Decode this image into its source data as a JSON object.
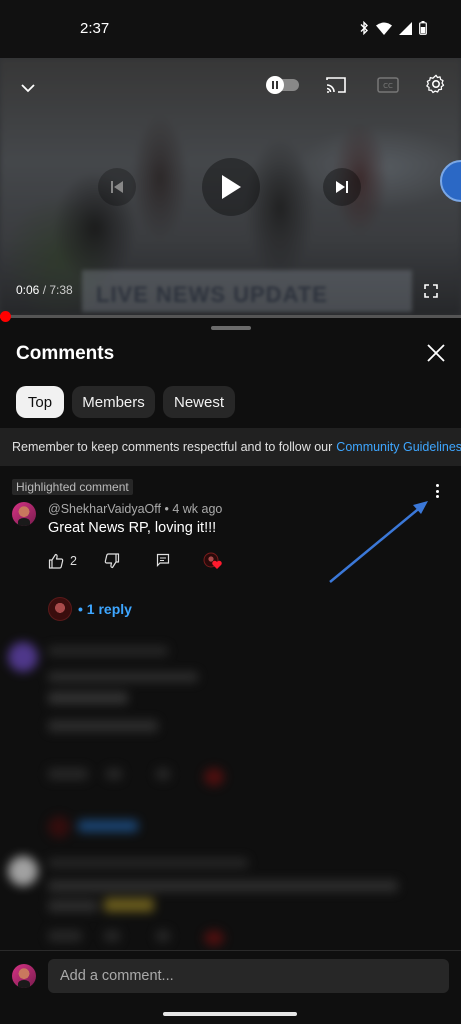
{
  "status_bar": {
    "time": "2:37",
    "icons": [
      "bluetooth-icon",
      "wifi-icon",
      "signal-icon",
      "battery-icon"
    ]
  },
  "player": {
    "current_time": "0:06",
    "duration": "7:38",
    "time_separator": " / ",
    "progress_fraction": 0.013,
    "overlay_text": "LIVE NEWS UPDATE",
    "controls": [
      "collapse-chevron-icon",
      "autoplay-toggle-icon",
      "cast-icon",
      "captions-icon",
      "settings-gear-icon",
      "previous-icon",
      "play-icon",
      "next-icon",
      "fullscreen-icon"
    ]
  },
  "comments": {
    "title": "Comments",
    "tabs": [
      {
        "label": "Top",
        "active": true
      },
      {
        "label": "Members",
        "active": false
      },
      {
        "label": "Newest",
        "active": false
      }
    ],
    "notice_text": "Remember to keep comments respectful and to follow our",
    "notice_link": "Community Guidelines",
    "highlighted_label": "Highlighted comment",
    "comment": {
      "author": "@ShekharVaidyaOff",
      "age": "4 wk ago",
      "meta_separator": " • ",
      "text": "Great News RP, loving it!!!",
      "likes": "2",
      "replies_label": "• 1 reply"
    },
    "composer_placeholder": "Add a comment..."
  },
  "colors": {
    "background": "#0f0f0f",
    "accent_link": "#3ea6ff",
    "progress": "#ff0000",
    "annotation_arrow": "#3b78d8"
  }
}
